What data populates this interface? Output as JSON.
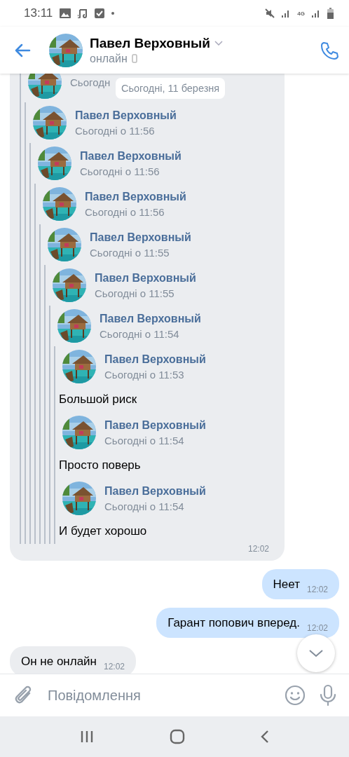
{
  "status_bar": {
    "time": "13:11",
    "network": "4G"
  },
  "header": {
    "name": "Павел Верховный",
    "status": "онлайн"
  },
  "date_pill": "Сьогодні, 11 березня",
  "messages": [
    {
      "kind": "forwarded",
      "time": "12:02",
      "forwarded": [
        {
          "time": "Сьогодн",
          "children": [
            {
              "author": "Павел Верховный",
              "time": "Сьогодні о 11:56",
              "children": [
                {
                  "author": "Павел Верховный",
                  "time": "Сьогодні о 11:56",
                  "children": [
                    {
                      "author": "Павел Верховный",
                      "time": "Сьогодні о 11:56",
                      "children": [
                        {
                          "author": "Павел Верховный",
                          "time": "Сьогодні о 11:55",
                          "children": [
                            {
                              "author": "Павел Верховный",
                              "time": "Сьогодні о 11:55",
                              "children": [
                                {
                                  "author": "Павел Верховный",
                                  "time": "Сьогодні о 11:54",
                                  "children": [
                                    {
                                      "author": "Павел Верховный",
                                      "time": "Сьогодні о 11:53",
                                      "text": "Большой риск"
                                    },
                                    {
                                      "author": "Павел Верховный",
                                      "time": "Сьогодні о 11:54",
                                      "text": "Просто поверь"
                                    },
                                    {
                                      "author": "Павел Верховный",
                                      "time": "Сьогодні о 11:54",
                                      "text": "И будет хорошо"
                                    }
                                  ]
                                }
                              ]
                            }
                          ]
                        }
                      ]
                    }
                  ]
                }
              ]
            }
          ]
        }
      ]
    },
    {
      "kind": "outgoing",
      "text": "Неет",
      "time": "12:02"
    },
    {
      "kind": "outgoing",
      "text": "Гарант попович вперед.",
      "time": "12:02"
    },
    {
      "kind": "incoming",
      "text": "Он не онлайн",
      "time": "12:02"
    }
  ],
  "composer": {
    "placeholder": "Повідомлення"
  }
}
